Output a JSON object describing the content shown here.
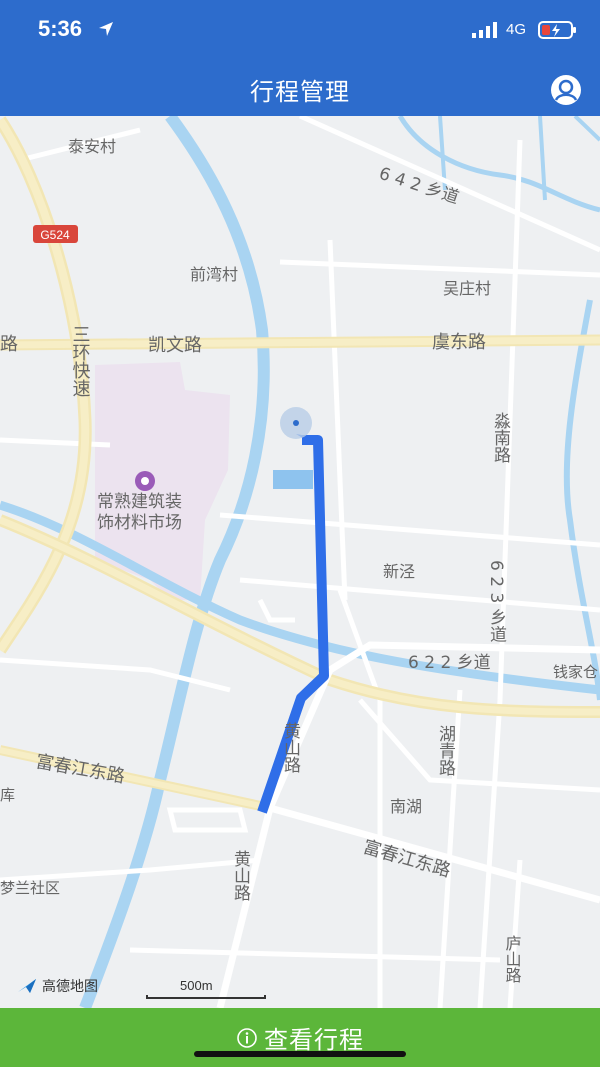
{
  "status_bar": {
    "time": "5:36",
    "network": "4G"
  },
  "header": {
    "title": "行程管理",
    "profile_icon": "user-circle-icon"
  },
  "map": {
    "labels": {
      "village1": "泰安村",
      "village2": "前湾村",
      "village3": "吴庄村",
      "village4": "新泾",
      "village5": "南湖",
      "village6": "钱家仓",
      "road_g524": "G524",
      "road_642": "6 4 2 乡道",
      "road_kaiwen": "凯文路",
      "road_yudong": "虞东路",
      "road_huan": "三环快速",
      "road_miaonan": "淼南路",
      "road_623": "6 2 3 乡道",
      "road_622": "6 2 2 乡道",
      "market1": "常熟建筑装",
      "market2": "饰材料市场",
      "road_fuchun1": "富春江东路",
      "road_fuchun2": "富春江东路",
      "road_huangshan1": "黄山路",
      "road_huangshan2": "黄山路",
      "road_huqing": "湖青路",
      "road_lushan": "庐山路",
      "lu_left": "路",
      "ku": "库",
      "menglan": "梦兰社区"
    },
    "route_color": "#2f6ee8",
    "logo_text": "高德地图",
    "scale_text": "500m"
  },
  "footer": {
    "button_label": "查看行程",
    "info_icon": "info-circle-icon",
    "color": "#5cb63a"
  }
}
